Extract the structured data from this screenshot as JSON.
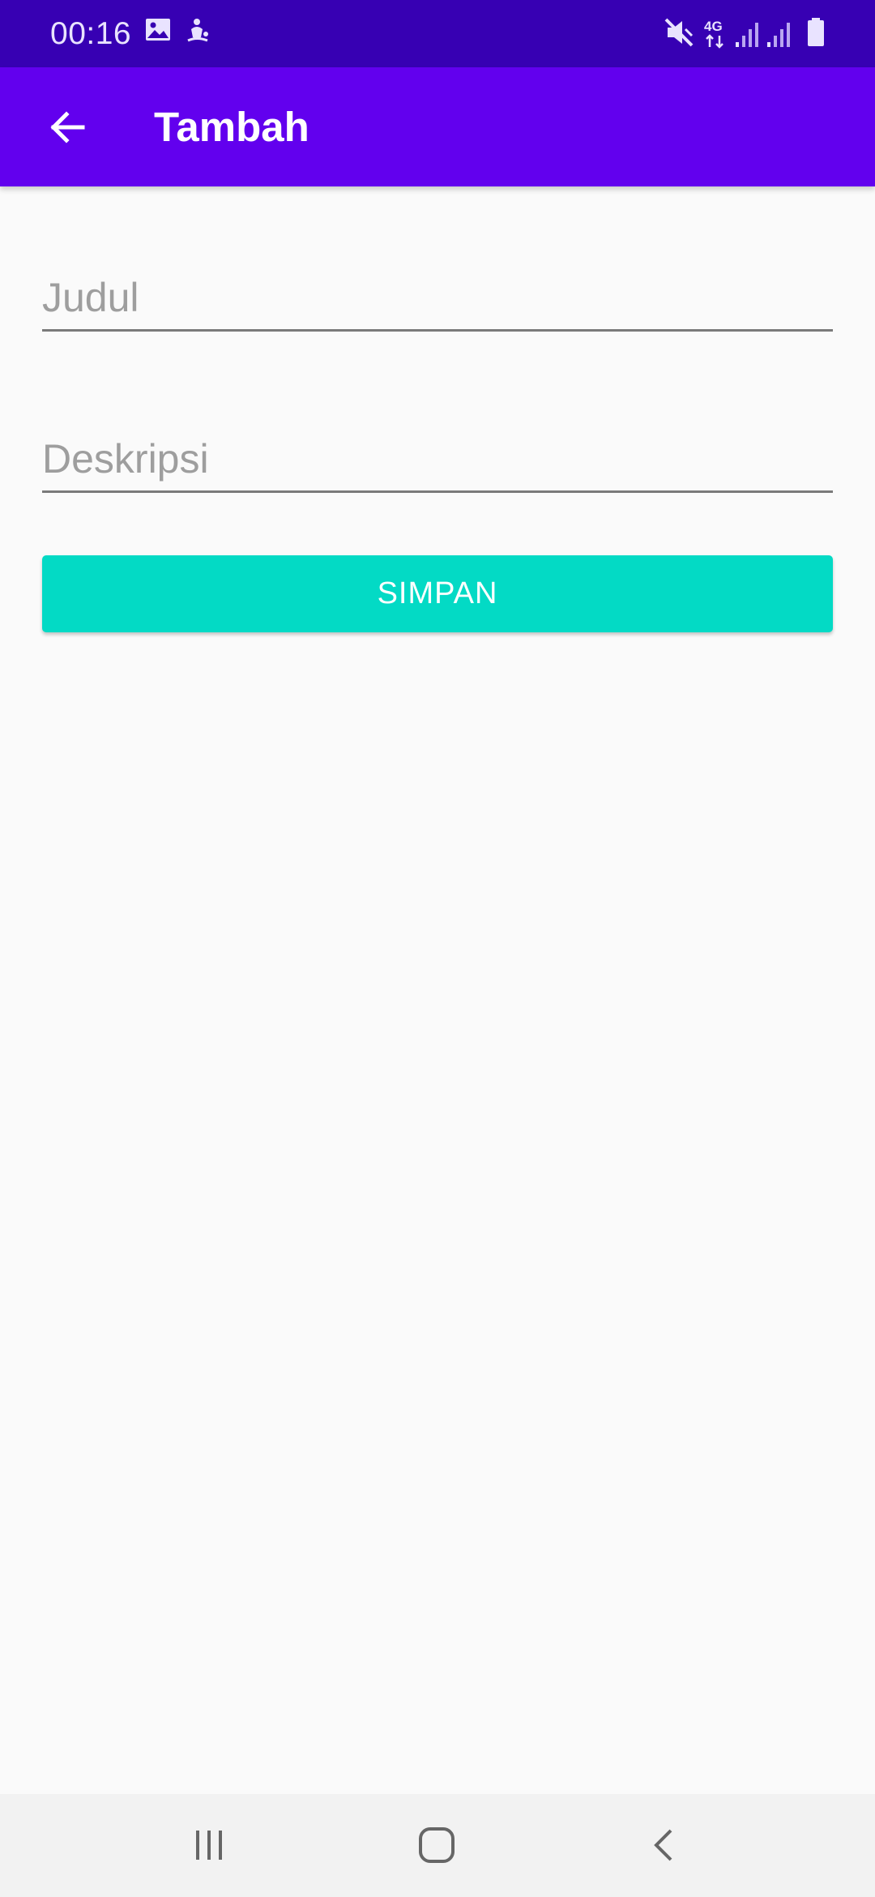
{
  "status_bar": {
    "time": "00:16",
    "network_label": "4G",
    "left_icons": [
      "image-icon",
      "android-debug-icon"
    ],
    "right_icons": [
      "mute-icon",
      "network-4g-icon",
      "signal-icon",
      "signal-icon",
      "battery-icon"
    ]
  },
  "app_bar": {
    "title": "Tambah",
    "back_icon": "arrow-left-icon"
  },
  "form": {
    "judul_placeholder": "Judul",
    "judul_value": "",
    "deskripsi_placeholder": "Deskripsi",
    "deskripsi_value": "",
    "save_label": "SIMPAN"
  },
  "nav_bar": {
    "items": [
      "recent-apps-icon",
      "home-icon",
      "back-icon"
    ]
  },
  "colors": {
    "status_bar": "#3700b3",
    "app_bar": "#6200ee",
    "accent": "#03dac5",
    "background": "#fafafa",
    "nav_bar": "#f2f2f2"
  }
}
